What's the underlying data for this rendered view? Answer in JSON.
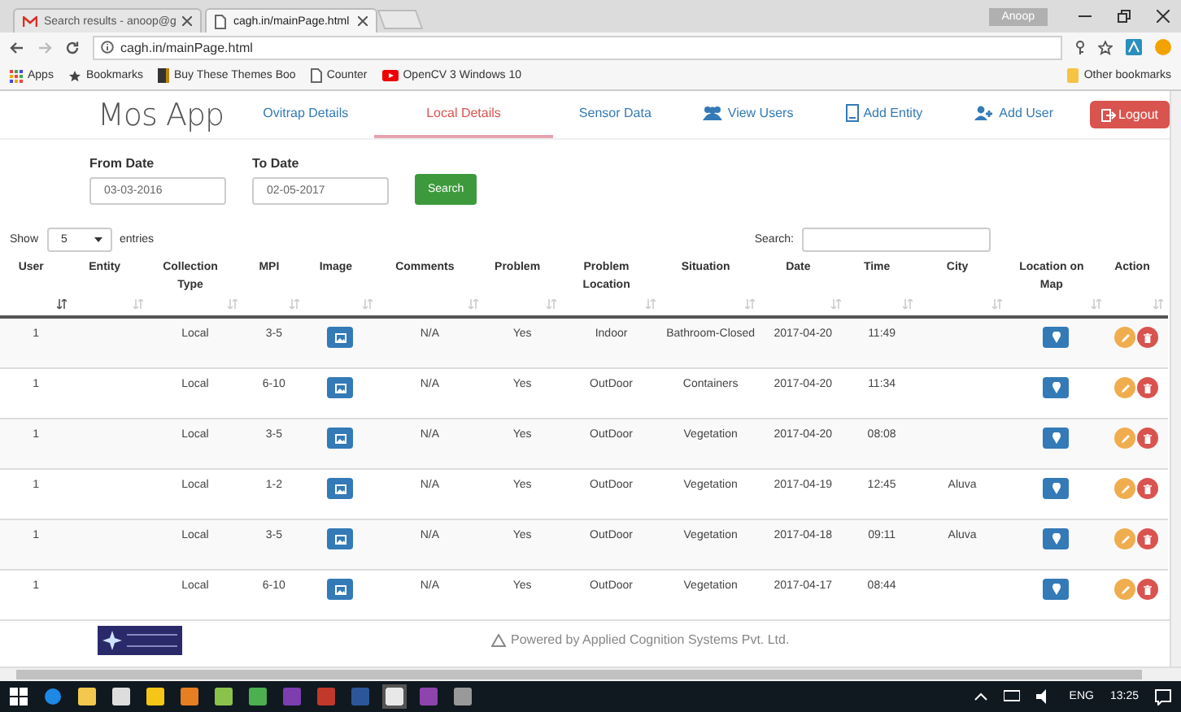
{
  "browser": {
    "tabs": [
      {
        "label": "Search results - anoop@g",
        "selected": false
      },
      {
        "label": "cagh.in/mainPage.html",
        "selected": true
      }
    ],
    "profile": "Anoop",
    "address": "cagh.in/mainPage.html",
    "bookmarks": [
      {
        "kind": "apps",
        "label": "Apps"
      },
      {
        "kind": "star",
        "label": "Bookmarks"
      },
      {
        "kind": "theme",
        "label": "Buy These Themes Boo"
      },
      {
        "kind": "page",
        "label": "Counter"
      },
      {
        "kind": "video",
        "label": "OpenCV 3 Windows 10"
      }
    ],
    "other_bookmarks": "Other bookmarks"
  },
  "app": {
    "brand": "Mos App",
    "nav": [
      {
        "kind": "link",
        "label": "Ovitrap Details",
        "selected": false
      },
      {
        "kind": "link",
        "label": "Local Details",
        "selected": true
      },
      {
        "kind": "link",
        "label": "Sensor Data",
        "selected": false
      },
      {
        "kind": "users",
        "label": "View Users",
        "selected": false
      },
      {
        "kind": "entity",
        "label": "Add Entity",
        "selected": false
      },
      {
        "kind": "add-user",
        "label": "Add User",
        "selected": false
      },
      {
        "kind": "logout",
        "label": "Logout",
        "selected": false
      }
    ]
  },
  "filter": {
    "from_label": "From Date",
    "from_value": "03-03-2016",
    "to_label": "To Date",
    "to_value": "02-05-2017",
    "search_button": "Search"
  },
  "table_controls": {
    "show_label": "Show",
    "entries_value": "5",
    "entries_label": "entries",
    "search_label": "Search:"
  },
  "table": {
    "columns": [
      {
        "label": "User",
        "sorted": true
      },
      {
        "label": "Entity",
        "sorted": false
      },
      {
        "label": "Collection Type",
        "sorted": false
      },
      {
        "label": "MPI",
        "sorted": false
      },
      {
        "label": "Image",
        "sorted": false
      },
      {
        "label": "Comments",
        "sorted": false
      },
      {
        "label": "Problem",
        "sorted": false
      },
      {
        "label": "Problem Location",
        "sorted": false
      },
      {
        "label": "Situation",
        "sorted": false
      },
      {
        "label": "Date",
        "sorted": false
      },
      {
        "label": "Time",
        "sorted": false
      },
      {
        "label": "City",
        "sorted": false
      },
      {
        "label": "Location on Map",
        "sorted": false
      },
      {
        "label": "Action",
        "sorted": false
      }
    ],
    "rows": [
      {
        "user": "1",
        "collection_type": "Local",
        "mpi": "3-5",
        "comments": "N/A",
        "problem": "Yes",
        "problem_location": "Indoor",
        "situation": "Bathroom-Closed",
        "date": "2017-04-20",
        "time": "11:49"
      },
      {
        "user": "1",
        "collection_type": "Local",
        "mpi": "6-10",
        "comments": "N/A",
        "problem": "Yes",
        "problem_location": "OutDoor",
        "situation": "Containers",
        "date": "2017-04-20",
        "time": "11:34"
      },
      {
        "user": "1",
        "collection_type": "Local",
        "mpi": "3-5",
        "comments": "N/A",
        "problem": "Yes",
        "problem_location": "OutDoor",
        "situation": "Vegetation",
        "date": "2017-04-20",
        "time": "08:08"
      },
      {
        "user": "1",
        "collection_type": "Local",
        "mpi": "1-2",
        "comments": "N/A",
        "problem": "Yes",
        "problem_location": "OutDoor",
        "situation": "Vegetation",
        "date": "2017-04-19",
        "time": "12:45",
        "city": "Aluva"
      },
      {
        "user": "1",
        "collection_type": "Local",
        "mpi": "3-5",
        "comments": "N/A",
        "problem": "Yes",
        "problem_location": "OutDoor",
        "situation": "Vegetation",
        "date": "2017-04-18",
        "time": "09:11",
        "city": "Aluva"
      },
      {
        "user": "1",
        "collection_type": "Local",
        "mpi": "6-10",
        "comments": "N/A",
        "problem": "Yes",
        "problem_location": "OutDoor",
        "situation": "Vegetation",
        "date": "2017-04-17",
        "time": "08:44"
      }
    ]
  },
  "footer": {
    "text": "Powered by Applied Cognition Systems Pvt. Ltd."
  },
  "taskbar": {
    "language": "ENG",
    "time": "13:25"
  }
}
